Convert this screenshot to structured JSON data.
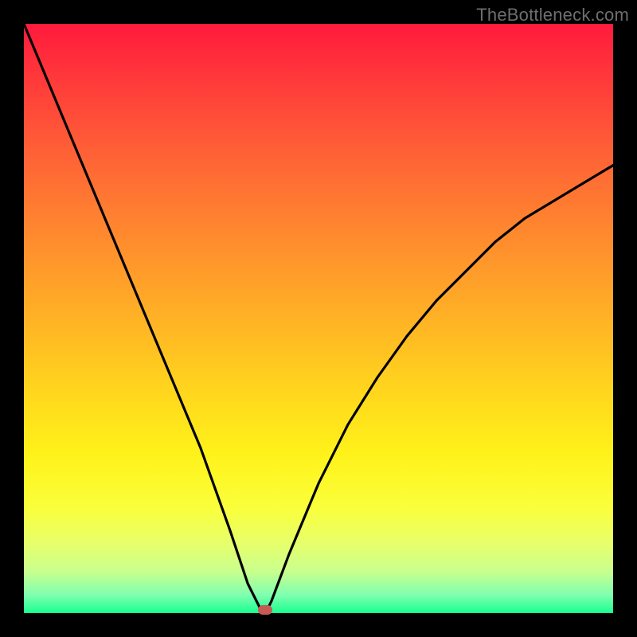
{
  "watermark": "TheBottleneck.com",
  "chart_data": {
    "type": "line",
    "title": "",
    "xlabel": "",
    "ylabel": "",
    "xlim": [
      0,
      100
    ],
    "ylim": [
      0,
      100
    ],
    "series": [
      {
        "name": "bottleneck-curve",
        "x": [
          0,
          5,
          10,
          15,
          20,
          25,
          30,
          35,
          38,
          40,
          41,
          42,
          45,
          50,
          55,
          60,
          65,
          70,
          75,
          80,
          85,
          90,
          95,
          100
        ],
        "values": [
          100,
          88,
          76,
          64,
          52,
          40,
          28,
          14,
          5,
          1,
          0,
          2,
          10,
          22,
          32,
          40,
          47,
          53,
          58,
          63,
          67,
          70,
          73,
          76
        ]
      }
    ],
    "marker": {
      "x": 41,
      "y": 0
    },
    "gradient_stops": [
      {
        "pos": 0,
        "color": "#ff1a3d"
      },
      {
        "pos": 50,
        "color": "#ffb225"
      },
      {
        "pos": 75,
        "color": "#fff21a"
      },
      {
        "pos": 100,
        "color": "#18ff8f"
      }
    ]
  }
}
